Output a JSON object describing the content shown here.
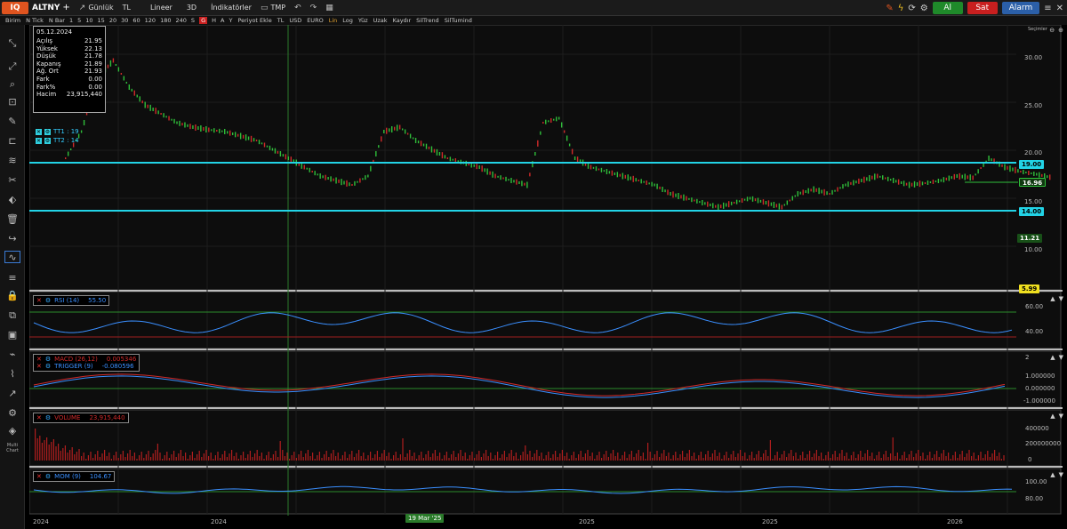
{
  "header": {
    "logo": "IQ",
    "symbol": "ALTNY",
    "add": "+",
    "period": "Günlük",
    "currency": "TL",
    "scale": "Lineer",
    "mode3d": "3D",
    "indicators": "İndikatörler",
    "tmp": "TMP",
    "buy_label": "Al",
    "sell_label": "Sat",
    "alarm_label": "Alarm"
  },
  "toolbar2": {
    "items": [
      "Birim",
      "N Tick",
      "N Bar",
      "1",
      "5",
      "10",
      "15",
      "20",
      "30",
      "60",
      "120",
      "180",
      "240",
      "S",
      "G",
      "H",
      "A",
      "Y",
      "Periyot Ekle",
      "TL",
      "USD",
      "EURO",
      "Lin",
      "Log",
      "Yüz",
      "Uzak",
      "Kaydır",
      "SilTrend",
      "SilTumind"
    ]
  },
  "sidebar": {
    "multi_chart": "Multi Chart"
  },
  "ohlc": {
    "date": "05.12.2024",
    "rows": [
      {
        "label": "Açılış",
        "value": "21.95"
      },
      {
        "label": "Yüksek",
        "value": "22.13"
      },
      {
        "label": "Düşük",
        "value": "21.78"
      },
      {
        "label": "Kapanış",
        "value": "21.89"
      },
      {
        "label": "Ağ. Ort",
        "value": "21.93"
      },
      {
        "label": "Fark",
        "value": "0.00"
      },
      {
        "label": "Fark%",
        "value": "0.00"
      },
      {
        "label": "Hacim",
        "value": "23,915,440"
      }
    ]
  },
  "trendlines": {
    "t1": "TT1 : 19",
    "t2": "TT2 : 14"
  },
  "price_axis": {
    "title": "Seçimler",
    "ticks": [
      "30.00",
      "25.00",
      "20.00",
      "15.00",
      "10.00"
    ],
    "tag_19": "19.00",
    "tag_last": "16.96",
    "tag_14": "14.00",
    "tag_low": "11.21",
    "tag_min": "5.99"
  },
  "rsi": {
    "label": "RSI (14)",
    "value": "55.50",
    "ticks": [
      "60.00",
      "40.00"
    ]
  },
  "macd": {
    "label": "MACD (26,12)",
    "value": "0.005346",
    "trigger_label": "TRIGGER (9)",
    "trigger_value": "-0.080596",
    "ticks": [
      "2",
      "1.000000",
      "0.000000",
      "-1.000000"
    ]
  },
  "volume": {
    "label": "VOLUME",
    "value": "23,915,440",
    "ticks": [
      "400000",
      "200000000",
      "0"
    ]
  },
  "mom": {
    "label": "MOM (9)",
    "value": "104.67",
    "ticks": [
      "100.00",
      "80.00"
    ]
  },
  "time_axis": {
    "labels": [
      "2024",
      "2024",
      "2025",
      "2025",
      "2026"
    ],
    "cursor_date": "19 Mar '25"
  },
  "colors": {
    "up": "#2fbf3a",
    "down": "#d02a2a",
    "hline": "#22d3e6",
    "rsi_line": "#3a8fff",
    "accent_orange": "#e0541f"
  }
}
